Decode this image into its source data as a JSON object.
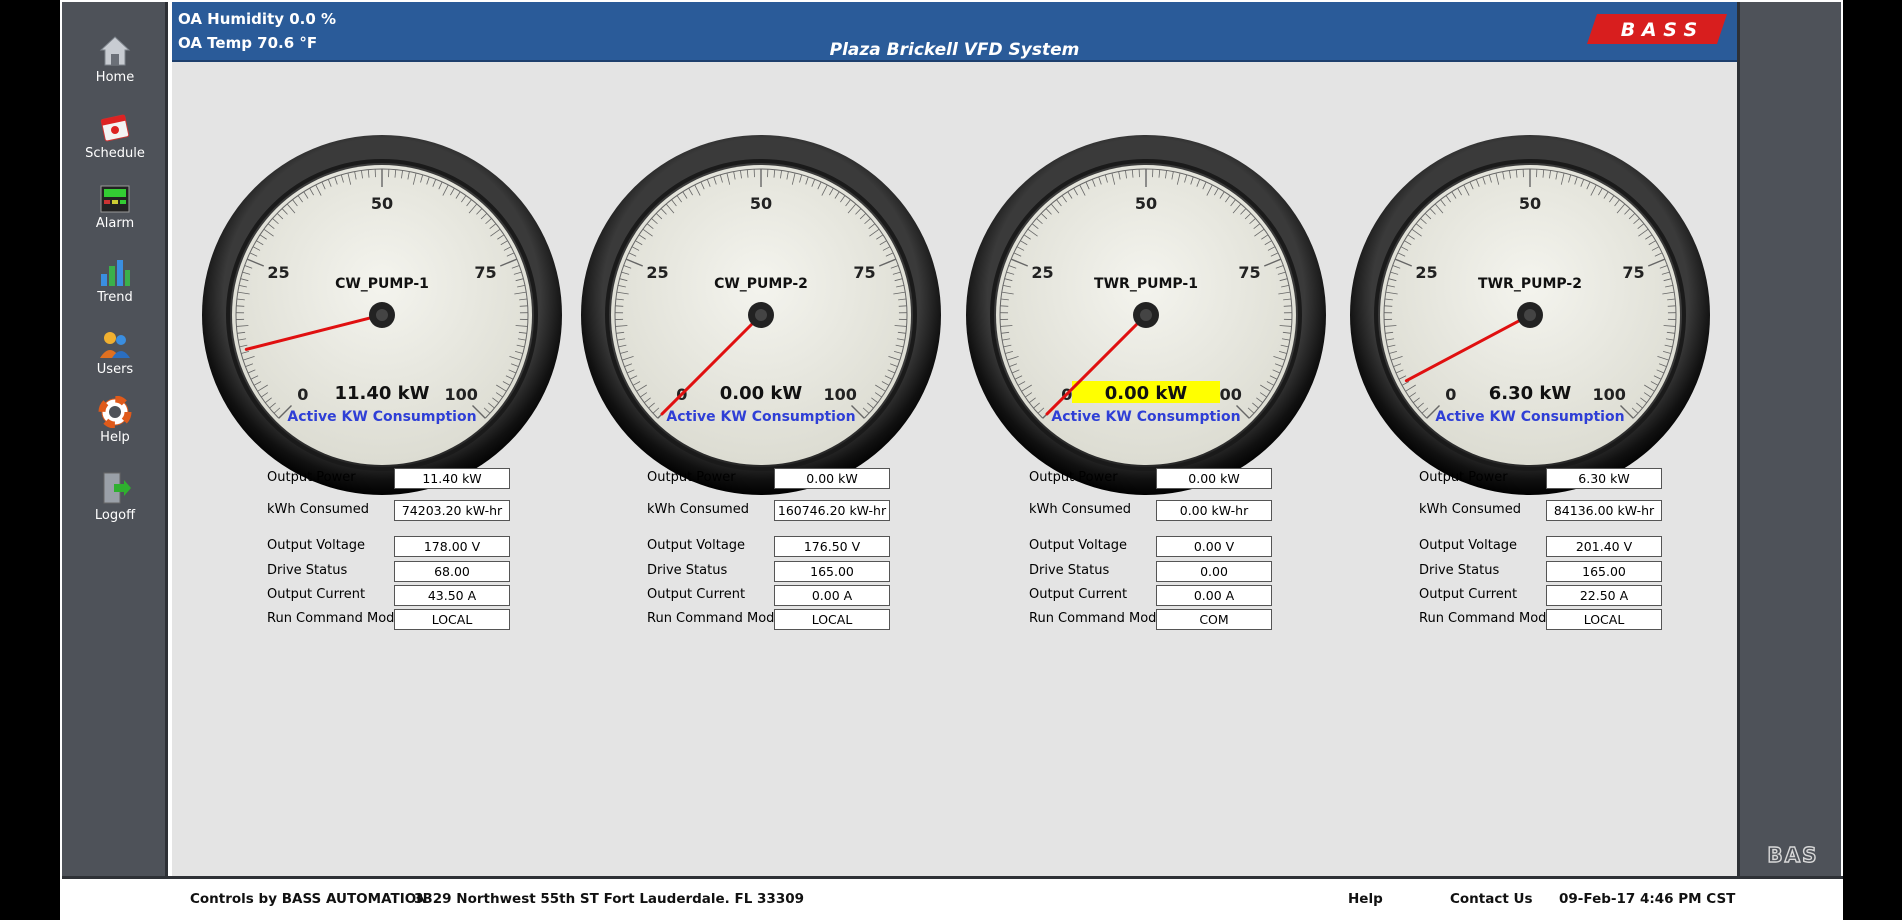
{
  "header": {
    "oa_humidity": "OA Humidity 0.0 %",
    "oa_temp": "OA Temp  70.6 °F",
    "title": "Plaza Brickell VFD System",
    "logo_text": "B A S S"
  },
  "nav": {
    "home": "Home",
    "schedule": "Schedule",
    "alarm": "Alarm",
    "trend": "Trend",
    "users": "Users",
    "help": "Help",
    "logoff": "Logoff"
  },
  "labels": {
    "output_power": "Output Power",
    "kwh_consumed": "kWh Consumed",
    "output_voltage": "Output Voltage",
    "drive_status": "Drive Status",
    "output_current": "Output Current",
    "run_command_mode": "Run Command Mode",
    "gauge_caption": "Active KW Consumption"
  },
  "scale": {
    "ticks": [
      "0",
      "25",
      "50",
      "75",
      "100"
    ],
    "min": 0,
    "max": 100
  },
  "pumps": [
    {
      "name": "CW_PUMP-1",
      "kw": 11.4,
      "kw_text": "11.40 kW",
      "highlight": false,
      "output_power": "11.40 kW",
      "kwh_consumed": "74203.20 kW-hr",
      "output_voltage": "178.00 V",
      "drive_status": "68.00",
      "output_current": "43.50 A",
      "run_command_mode": "LOCAL"
    },
    {
      "name": "CW_PUMP-2",
      "kw": 0.0,
      "kw_text": "0.00 kW",
      "highlight": false,
      "output_power": "0.00 kW",
      "kwh_consumed": "160746.20 kW-hr",
      "output_voltage": "176.50 V",
      "drive_status": "165.00",
      "output_current": "0.00 A",
      "run_command_mode": "LOCAL"
    },
    {
      "name": "TWR_PUMP-1",
      "kw": 0.0,
      "kw_text": "0.00 kW",
      "highlight": true,
      "output_power": "0.00 kW",
      "kwh_consumed": "0.00 kW-hr",
      "output_voltage": "0.00 V",
      "drive_status": "0.00",
      "output_current": "0.00 A",
      "run_command_mode": "COM"
    },
    {
      "name": "TWR_PUMP-2",
      "kw": 6.3,
      "kw_text": "6.30 kW",
      "highlight": false,
      "output_power": "6.30 kW",
      "kwh_consumed": "84136.00 kW-hr",
      "output_voltage": "201.40 V",
      "drive_status": "165.00",
      "output_current": "22.50 A",
      "run_command_mode": "LOCAL"
    }
  ],
  "footer": {
    "controls_by": "Controls by BASS AUTOMATION",
    "address": "3329 Northwest 55th ST Fort Lauderdale. FL 33309",
    "help": "Help",
    "contact": "Contact Us",
    "datetime": "09-Feb-17 4:46 PM CST"
  },
  "bas_mark": "BAS",
  "colors": {
    "header_blue": "#2a5b99",
    "needle": "#e01010",
    "caption": "#2f3fd6",
    "highlight": "#ffff00"
  }
}
